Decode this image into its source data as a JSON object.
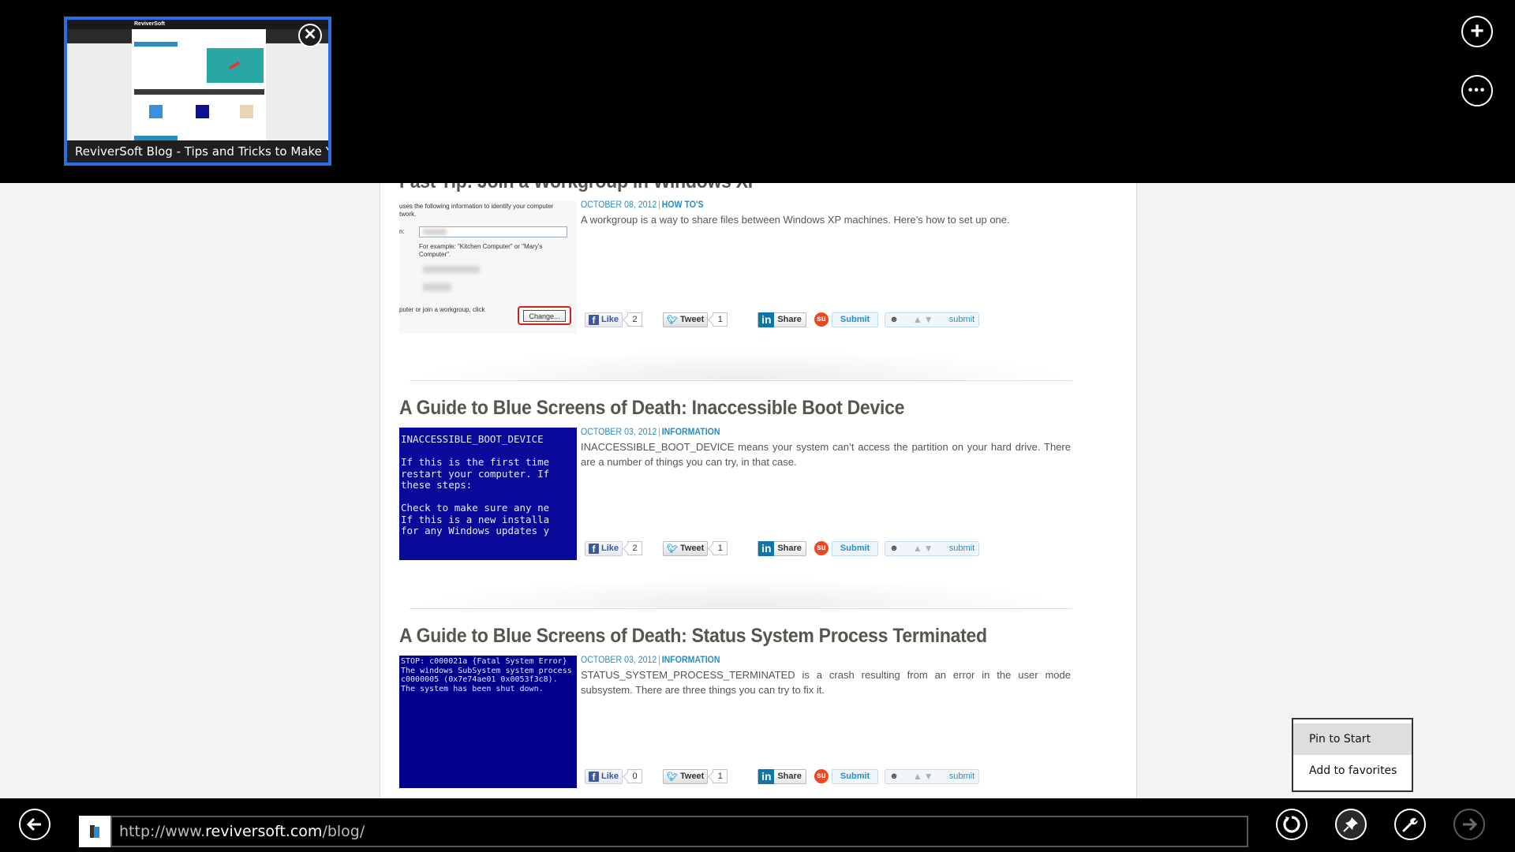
{
  "browser": {
    "tabs": [
      {
        "title": "ReviverSoft Blog - Tips and Tricks to Make Yo...",
        "preview_logo": "ReviverSoft",
        "active": true
      }
    ],
    "new_tab_icon": "plus-icon",
    "tab_tools_icon": "ellipsis-icon",
    "close_tab_icon": "close-icon",
    "address": {
      "prefix": "http://www.",
      "domain": "reviversoft.com",
      "suffix": "/blog/"
    },
    "nav_icons": {
      "back": "back-arrow-icon",
      "refresh": "refresh-icon",
      "pin": "pin-icon",
      "tools": "wrench-icon",
      "forward": "forward-arrow-icon"
    },
    "pin_menu": {
      "items": [
        {
          "label": "Pin to Start",
          "highlighted": true
        },
        {
          "label": "Add to favorites",
          "highlighted": false
        }
      ]
    }
  },
  "posts": [
    {
      "title": "Fast Tip: Join a Workgroup in Windows XP",
      "date": "OCTOBER 08, 2012",
      "category": "HOW TO'S",
      "excerpt": "A workgroup is a way to share files between Windows XP machines. Here’s how to set up one.",
      "thumbnail": {
        "type": "dialog",
        "line1": "uses the following information to identify your computer",
        "line2": "twork.",
        "label_colon": "n:",
        "example1": "For example: \"Kitchen Computer\" or \"Mary's",
        "example2": "Computer\".",
        "join_text": "puter or join a workgroup, click",
        "button": "Change..."
      },
      "social": {
        "like_label": "Like",
        "likes": "2",
        "tweet_label": "Tweet",
        "tweets": "1",
        "share_label": "Share",
        "submit_label": "Submit",
        "reddit_label": "submit"
      }
    },
    {
      "title": "A Guide to Blue Screens of Death: Inaccessible Boot Device",
      "date": "OCTOBER 03, 2012",
      "category": "INFORMATION",
      "excerpt": "INACCESSIBLE_BOOT_DEVICE means your system can’t access the partition on your hard drive. There are a number of things you can try, in that case.",
      "thumbnail": {
        "type": "bsod",
        "text": "INACCESSIBLE_BOOT_DEVICE\n\nIf this is the first time\nrestart your computer. If\nthese steps:\n\nCheck to make sure any ne\nIf this is a new installa\nfor any Windows updates y"
      },
      "social": {
        "like_label": "Like",
        "likes": "2",
        "tweet_label": "Tweet",
        "tweets": "1",
        "share_label": "Share",
        "submit_label": "Submit",
        "reddit_label": "submit"
      }
    },
    {
      "title": "A Guide to Blue Screens of Death: Status System Process Terminated",
      "date": "OCTOBER 03, 2012",
      "category": "INFORMATION",
      "excerpt": "STATUS_SYSTEM_PROCESS_TERMINATED is a crash resulting from an error in the user mode subsystem. There are three things you can try to fix it.",
      "thumbnail": {
        "type": "bsod",
        "text": "STOP: c000021a {Fatal System Error}\nThe windows SubSystem system process\nc0000005 (0x7e74ae01 0x0053f3c8).\nThe system has been shut down."
      },
      "social": {
        "like_label": "Like",
        "likes": "0",
        "tweet_label": "Tweet",
        "tweets": "1",
        "share_label": "Share",
        "submit_label": "Submit",
        "reddit_label": "submit"
      }
    }
  ],
  "colors": {
    "accent_blue": "#2a6ee5",
    "link_blue": "#2a8dbf",
    "title_gray": "#55574c",
    "bsod_blue": "#0a0a9a"
  }
}
